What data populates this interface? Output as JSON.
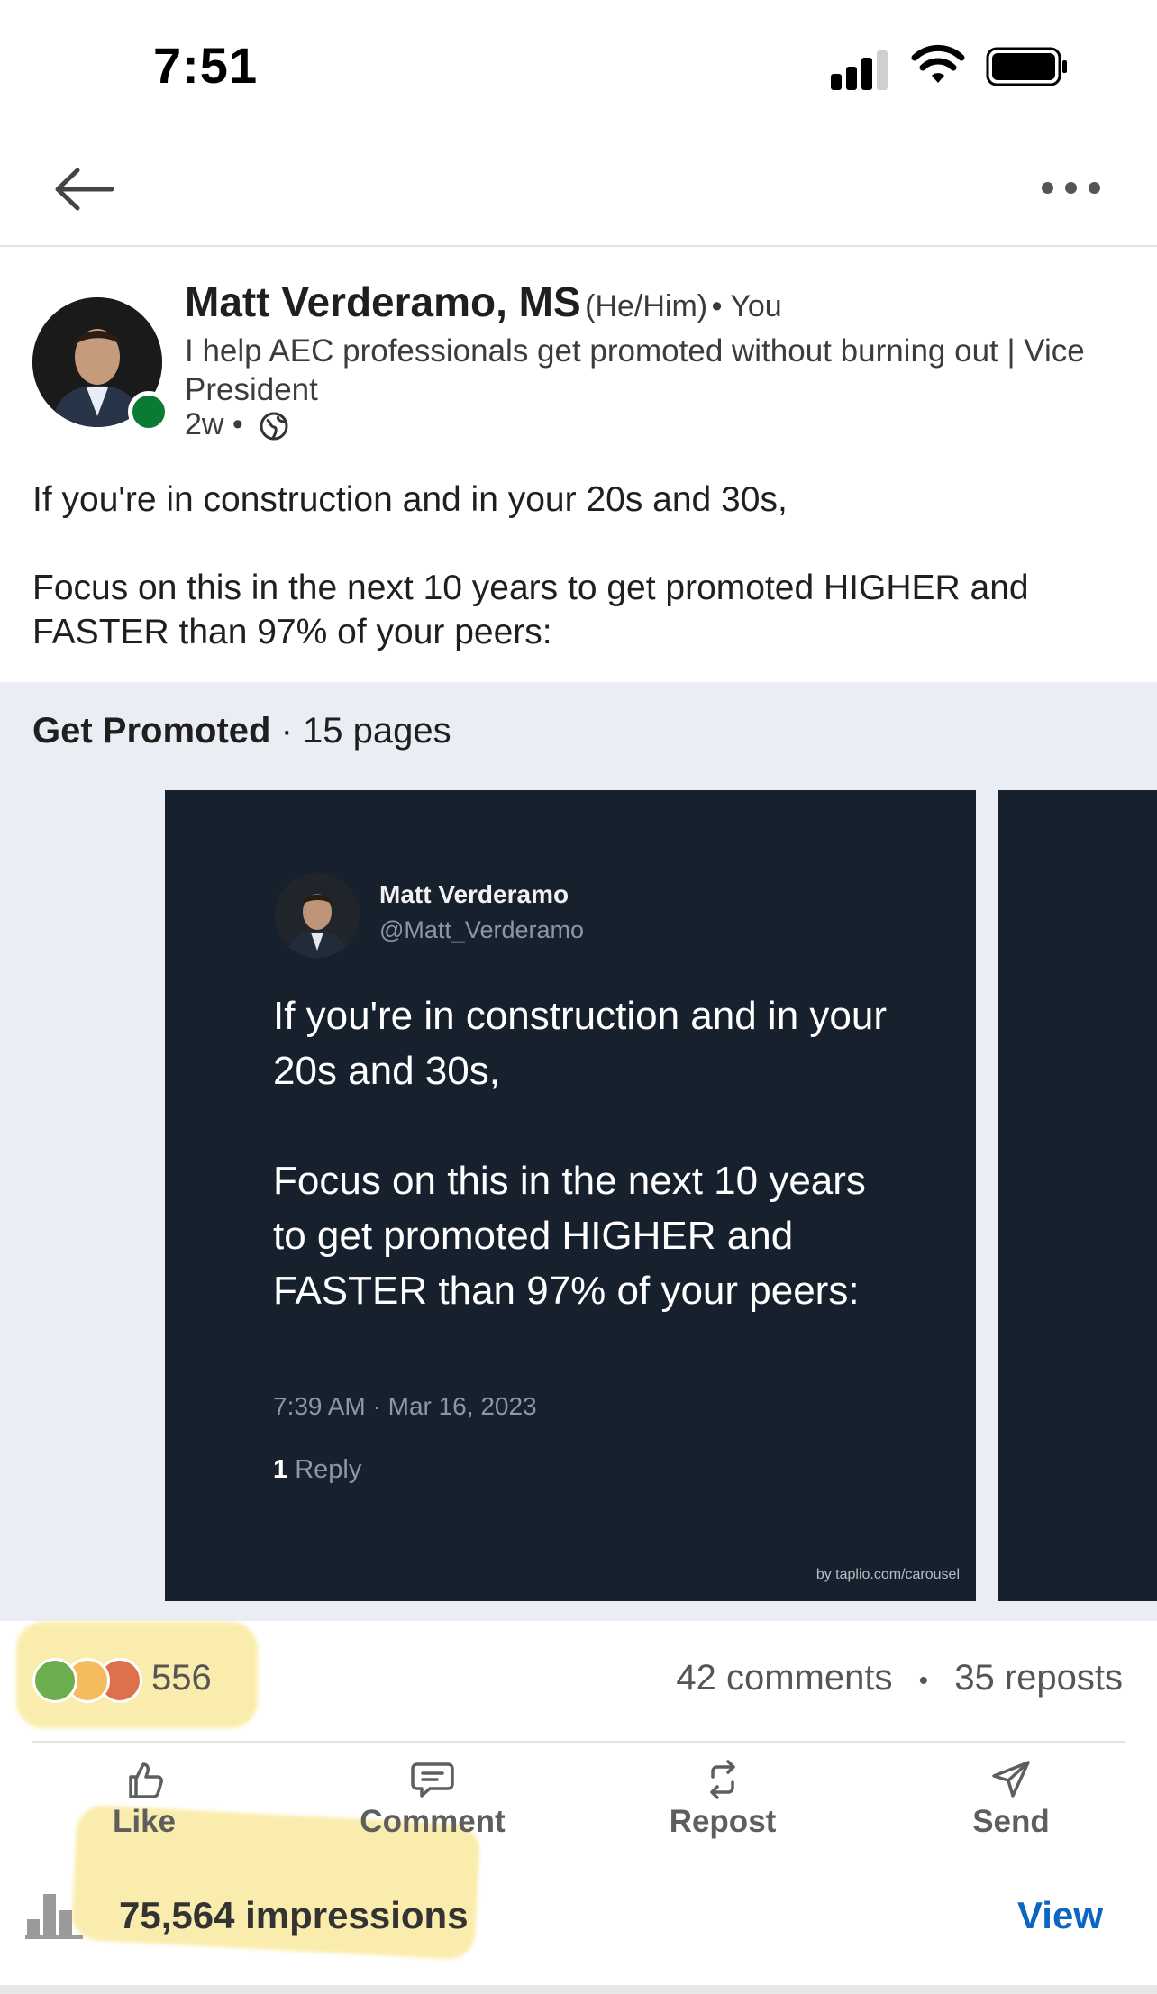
{
  "status_bar": {
    "time": "7:51"
  },
  "post": {
    "author_name": "Matt Verderamo, MS",
    "pronouns": "(He/Him)",
    "relation": "You",
    "headline": "I help AEC professionals get promoted without burning out | Vice President",
    "time_ago": "2w",
    "text_lines": [
      "If you're in construction and in your 20s and 30s,",
      "Focus on this in the next 10 years to get promoted HIGHER and FASTER than 97% of your peers:"
    ]
  },
  "document": {
    "title": "Get Promoted",
    "pages": "15 pages",
    "slide": {
      "name": "Matt Verderamo",
      "handle": "@Matt_Verderamo",
      "paragraph1": "If you're in construction and in your 20s and 30s,",
      "paragraph2": "Focus on this in the next 10 years to get promoted HIGHER and FASTER than 97% of your peers:",
      "timestamp": "7:39 AM · Mar 16, 2023",
      "reply_count": "1",
      "reply_label": "Reply",
      "credit": "by taplio.com/carousel"
    }
  },
  "social": {
    "reaction_count": "556",
    "comments": "42 comments",
    "reposts": "35 reposts",
    "separator": "•"
  },
  "actions": {
    "like": "Like",
    "comment": "Comment",
    "repost": "Repost",
    "send": "Send"
  },
  "impressions": {
    "label": "75,564 impressions",
    "view": "View"
  },
  "colors": {
    "link_blue": "#0a66c2",
    "slide_bg": "#16212d",
    "carousel_bg": "#eaedf4",
    "presence_green": "#0a7a35",
    "highlight": "#f7e27a"
  }
}
